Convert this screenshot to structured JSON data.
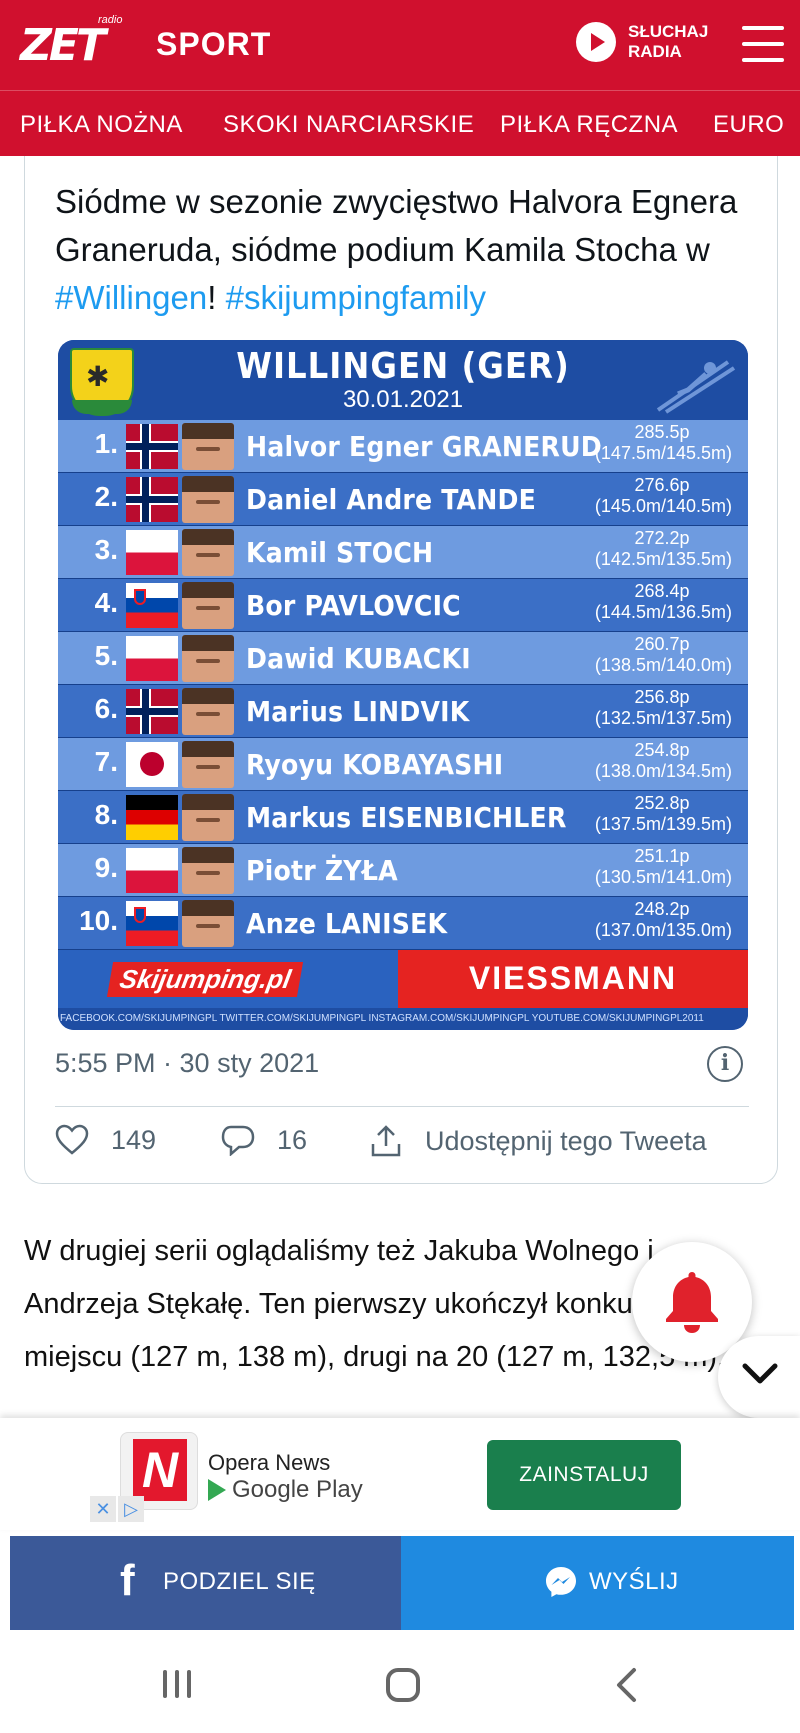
{
  "header": {
    "logo_text": "ZET",
    "logo_radio": "radio",
    "section": "SPORT",
    "listen_label_line1": "SŁUCHAJ",
    "listen_label_line2": "RADIA",
    "brand_color": "#d0102e"
  },
  "nav": {
    "items": [
      "PIŁKA NOŻNA",
      "SKOKI NARCIARSKIE",
      "PIŁKA RĘCZNA",
      "EURO"
    ]
  },
  "tweet": {
    "text_plain": "Siódme w sezonie zwycięstwo Halvora Egnera Graneruda, siódme podium Kamila Stocha w ",
    "hashtag1": "#Willingen",
    "text_mid": "! ",
    "hashtag2": "#skijumpingfamily",
    "time": "5:55 PM · 30 sty 2021",
    "likes": "149",
    "replies": "16",
    "share_label": "Udostępnij tego Tweeta",
    "link_color": "#1d9bf0"
  },
  "results_card": {
    "title": "WILLINGEN (GER)",
    "date": "30.01.2021",
    "rows": [
      {
        "rank": "1.",
        "flag": "NOR",
        "name": "Halvor Egner GRANERUD",
        "points": "285.5p",
        "jumps": "(147.5m/145.5m)"
      },
      {
        "rank": "2.",
        "flag": "NOR",
        "name": "Daniel Andre TANDE",
        "points": "276.6p",
        "jumps": "(145.0m/140.5m)"
      },
      {
        "rank": "3.",
        "flag": "POL",
        "name": "Kamil STOCH",
        "points": "272.2p",
        "jumps": "(142.5m/135.5m)"
      },
      {
        "rank": "4.",
        "flag": "SLO",
        "name": "Bor PAVLOVCIC",
        "points": "268.4p",
        "jumps": "(144.5m/136.5m)"
      },
      {
        "rank": "5.",
        "flag": "POL",
        "name": "Dawid KUBACKI",
        "points": "260.7p",
        "jumps": "(138.5m/140.0m)"
      },
      {
        "rank": "6.",
        "flag": "NOR",
        "name": "Marius LINDVIK",
        "points": "256.8p",
        "jumps": "(132.5m/137.5m)"
      },
      {
        "rank": "7.",
        "flag": "JPN",
        "name": "Ryoyu KOBAYASHI",
        "points": "254.8p",
        "jumps": "(138.0m/134.5m)"
      },
      {
        "rank": "8.",
        "flag": "GER",
        "name": "Markus EISENBICHLER",
        "points": "252.8p",
        "jumps": "(137.5m/139.5m)"
      },
      {
        "rank": "9.",
        "flag": "POL",
        "name": "Piotr ŻYŁA",
        "points": "251.1p",
        "jumps": "(130.5m/141.0m)"
      },
      {
        "rank": "10.",
        "flag": "SLO",
        "name": "Anze LANISEK",
        "points": "248.2p",
        "jumps": "(137.0m/135.0m)"
      }
    ],
    "sponsor_left": "Skijumping.pl",
    "sponsor_right": "VIESSMANN",
    "social_line": "FACEBOOK.COM/SKIJUMPINGPL TWITTER.COM/SKIJUMPINGPL INSTAGRAM.COM/SKIJUMPINGPL YOUTUBE.COM/SKIJUMPINGPL2011"
  },
  "article": {
    "paragraph": "W drugiej serii oglądaliśmy też Jakuba Wolnego i Andrzeja Stękałę. Ten pierwszy ukończył konkurs na 17. miejscu (127 m, 138 m), drugi na 20 (127 m, 132,5 m)."
  },
  "ad": {
    "app_name": "Opera News",
    "store": "Google Play",
    "cta": "ZAINSTALUJ",
    "close_x": "✕",
    "adchoices": "▷"
  },
  "share": {
    "facebook": "PODZIEL SIĘ",
    "messenger": "WYŚLIJ"
  }
}
